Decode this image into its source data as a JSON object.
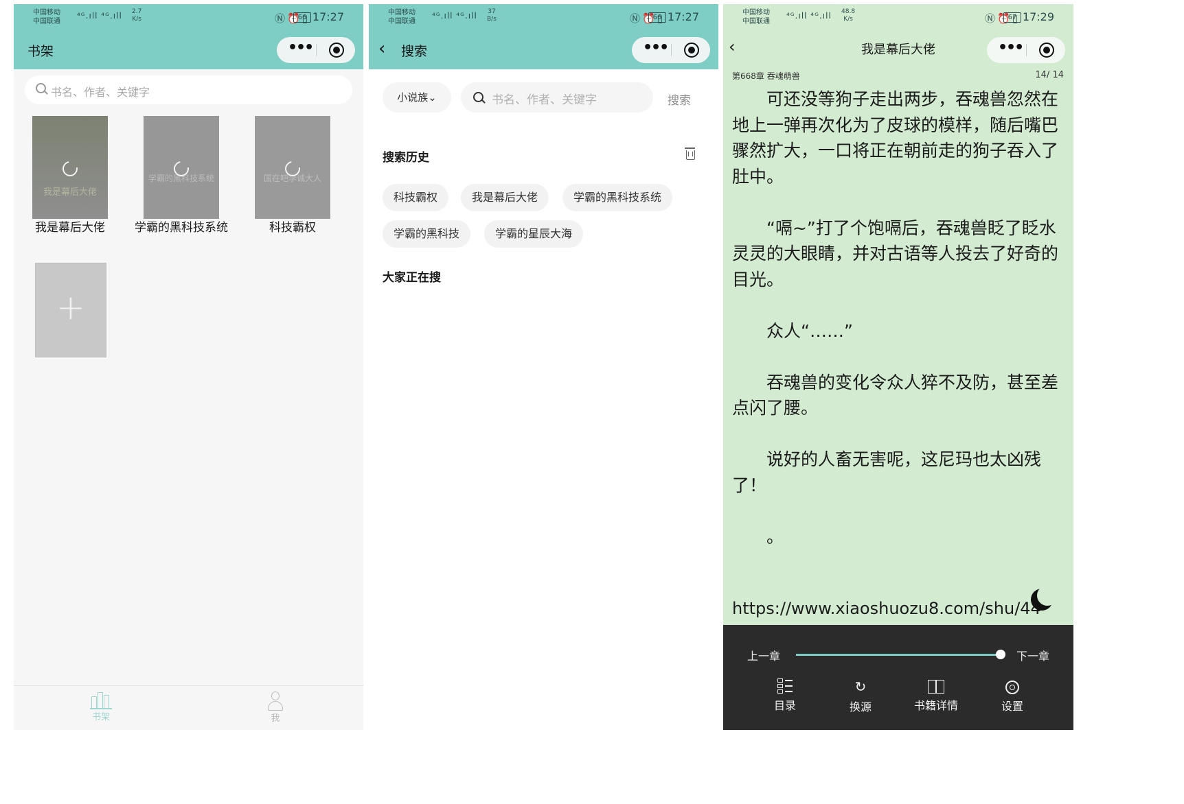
{
  "status": {
    "carrier1": "中国移动",
    "carrier2": "中国联通",
    "signal": "⁴ᴳ.ıll ⁴ᴳ.ıll",
    "phones": [
      {
        "speed_val": "2.7",
        "speed_unit": "K/s",
        "battery": "66",
        "time": "17:27"
      },
      {
        "speed_val": "37",
        "speed_unit": "B/s",
        "battery": "66",
        "time": "17:27"
      },
      {
        "speed_val": "48.8",
        "speed_unit": "K/s",
        "battery": "67",
        "time": "17:29"
      }
    ]
  },
  "bookshelf": {
    "title": "书架",
    "search_placeholder": "书名、作者、关键字",
    "books": [
      {
        "name": "我是幕后大佬",
        "cover_text": "我是幕后大佬"
      },
      {
        "name": "学霸的黑科技系统",
        "cover_text": "学霸的黑科技系统"
      },
      {
        "name": "科技霸权",
        "cover_text": "国在吧李诚大人"
      }
    ],
    "add_label": "+",
    "tabs": [
      {
        "label": "书架",
        "icon": "bookshelf-icon",
        "active": true
      },
      {
        "label": "我",
        "icon": "person-icon",
        "active": false
      }
    ]
  },
  "search": {
    "title": "搜索",
    "category": "小说族⌄",
    "search_placeholder": "书名、作者、关键字",
    "search_button": "搜索",
    "history_title": "搜索历史",
    "history": [
      "科技霸权",
      "我是幕后大佬",
      "学霸的黑科技系统",
      "学霸的黑科技",
      "学霸的星辰大海"
    ],
    "trending_title": "大家正在搜"
  },
  "reader": {
    "title": "我是幕后大佬",
    "chapter": "第668章 吞魂萌兽",
    "page": "14/ 14",
    "paragraphs": [
      "可还没等狗子走出两步，吞魂兽忽然在地上一弹再次化为了皮球的模样，随后嘴巴骤然扩大，一口将正在朝前走的狗子吞入了肚中。",
      "“嗝~”打了个饱嗝后，吞魂兽眨了眨水灵灵的大眼睛，并对古语等人投去了好奇的目光。",
      "众人“……”",
      "吞魂兽的变化令众人猝不及防，甚至差点闪了腰。",
      "说好的人畜无害呢，这尼玛也太凶残了！",
      "。"
    ],
    "url": "https://www.xiaoshuozu8.com/shu/44",
    "prev_chapter": "上一章",
    "next_chapter": "下一章",
    "progress": 1.0,
    "toolbar": [
      {
        "label": "目录",
        "icon": "catalog-icon"
      },
      {
        "label": "换源",
        "icon": "refresh-icon"
      },
      {
        "label": "书籍详情",
        "icon": "book-detail-icon"
      },
      {
        "label": "设置",
        "icon": "settings-icon"
      }
    ]
  },
  "colors": {
    "teal": "#7ecec5",
    "reader_bg": "#d3ebd1",
    "toolbar_bg": "#2b2b2b",
    "cover_gray": "#8f8f8f"
  }
}
